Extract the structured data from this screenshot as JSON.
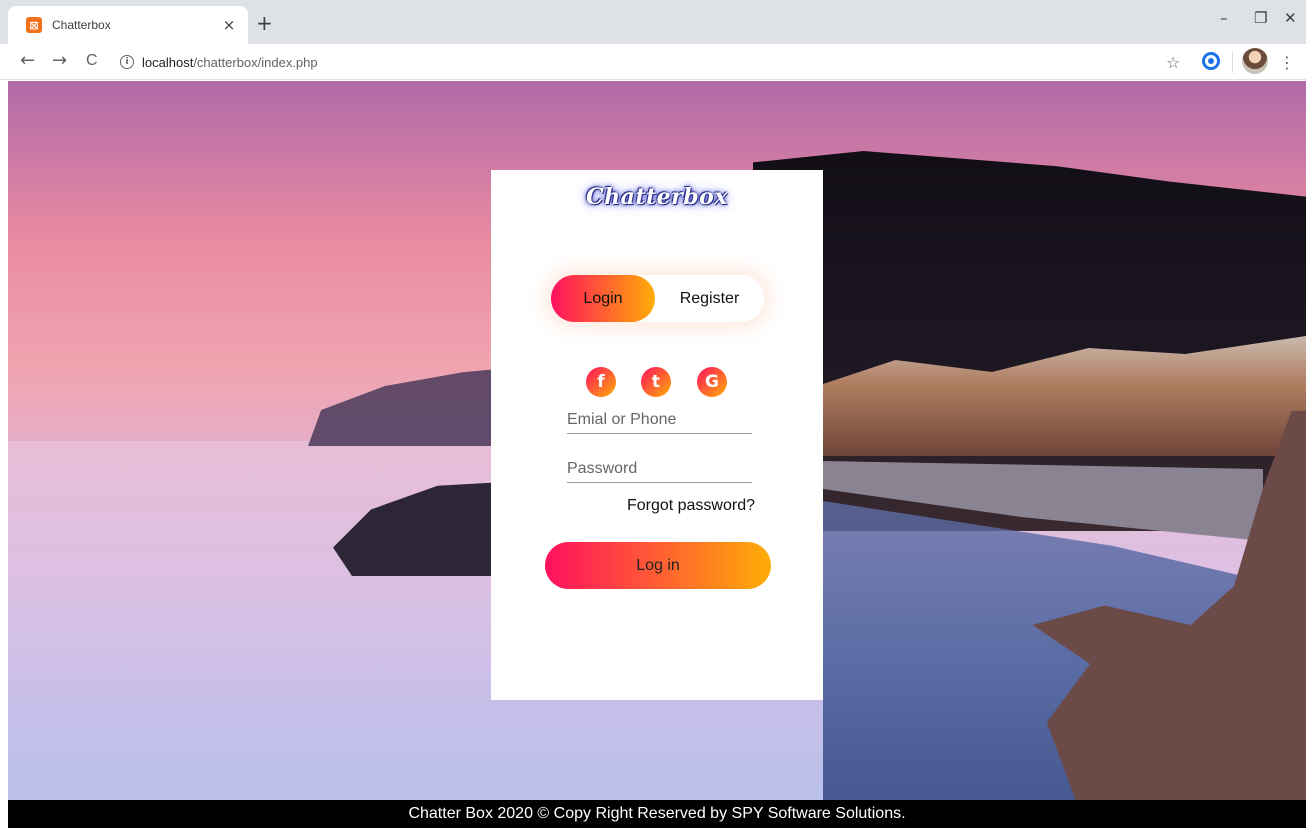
{
  "browser": {
    "tab_title": "Chatterbox",
    "tab_favicon_glyph": "⊠",
    "new_tab_glyph": "+",
    "close_glyph": "×",
    "url_host": "localhost",
    "url_path": "/chatterbox/index.php",
    "info_glyph": "i",
    "back_glyph": "←",
    "forward_glyph": "→",
    "reload_glyph": "C",
    "star_glyph": "☆",
    "menu_glyph": "⋮",
    "minimize_glyph": "–",
    "restore_glyph": "❐",
    "window_close_glyph": "✕"
  },
  "login_card": {
    "brand": "Chatterbox",
    "tabs": {
      "login": "Login",
      "register": "Register"
    },
    "social": [
      {
        "glyph": "f",
        "icon": "facebook-icon"
      },
      {
        "glyph": "t",
        "icon": "twitter-icon"
      },
      {
        "glyph": "G",
        "icon": "google-icon"
      }
    ],
    "email_placeholder": "Emial or Phone",
    "password_placeholder": "Password",
    "forgot_password": "Forgot password?",
    "submit": "Log in"
  },
  "footer": {
    "text": "Chatter Box 2020 © Copy Right Reserved by SPY Software Solutions."
  },
  "colors": {
    "accent_start": "#ff105f",
    "accent_end": "#ffad06",
    "footer_bg": "#000000",
    "chrome_bg": "#dee1e6"
  }
}
